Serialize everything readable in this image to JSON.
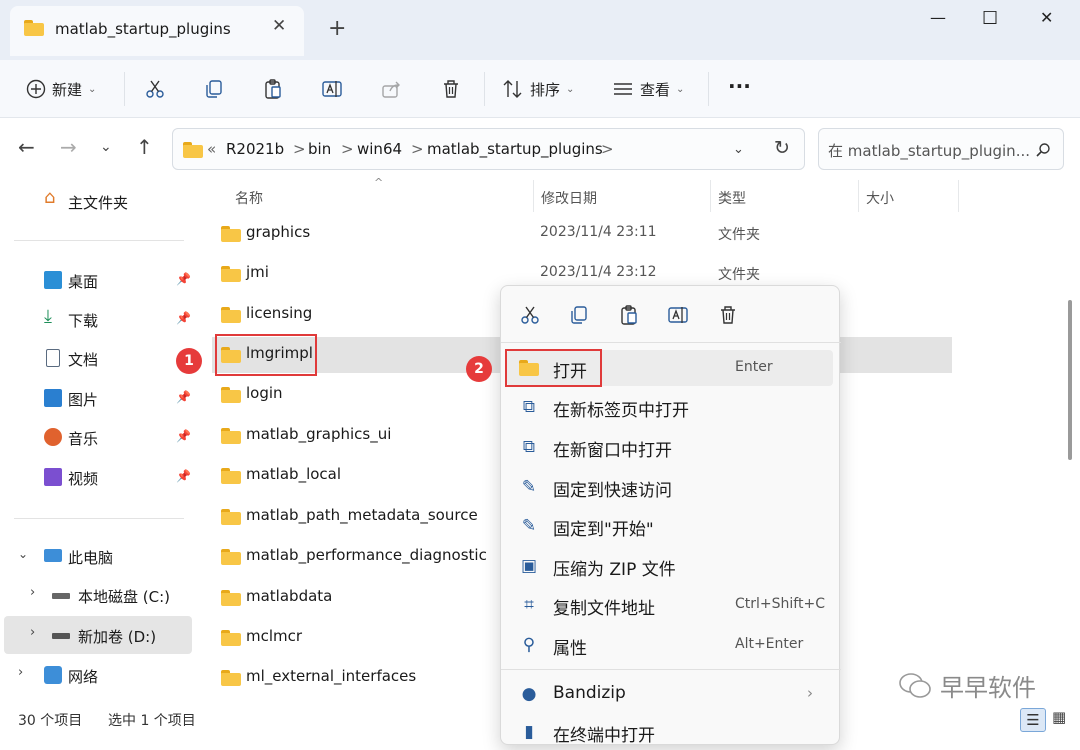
{
  "window": {
    "tab_title": "matlab_startup_plugins",
    "new_tab": "+",
    "minimize": "—",
    "maximize": "☐",
    "close": "✕"
  },
  "toolbar": {
    "new_label": "新建",
    "sort_label": "排序",
    "view_label": "查看",
    "more_label": "···"
  },
  "address": {
    "prefix": "«",
    "crumbs": [
      "R2021b",
      "bin",
      "win64",
      "matlab_startup_plugins"
    ],
    "separator": ">",
    "search_placeholder": "在 matlab_startup_plugin..."
  },
  "sidebar": {
    "home": "主文件夹",
    "quick": [
      {
        "label": "桌面",
        "icon": "desktop-icon",
        "color": "#2b8fd6"
      },
      {
        "label": "下载",
        "icon": "download-icon",
        "color": "#1f8f5a"
      },
      {
        "label": "文档",
        "icon": "document-icon",
        "color": "#5a6b80"
      },
      {
        "label": "图片",
        "icon": "pictures-icon",
        "color": "#2a7fd0"
      },
      {
        "label": "音乐",
        "icon": "music-icon",
        "color": "#e0622e"
      },
      {
        "label": "视频",
        "icon": "video-icon",
        "color": "#7b4fd0"
      }
    ],
    "this_pc": "此电脑",
    "drive_c": "本地磁盘 (C:)",
    "drive_d": "新加卷 (D:)",
    "network": "网络"
  },
  "columns": {
    "name": "名称",
    "modified": "修改日期",
    "type": "类型",
    "size": "大小"
  },
  "files": [
    {
      "name": "graphics",
      "date": "2023/11/4 23:11",
      "type": "文件夹"
    },
    {
      "name": "jmi",
      "date": "2023/11/4 23:12",
      "type": "文件夹"
    },
    {
      "name": "licensing",
      "date": "",
      "type": ""
    },
    {
      "name": "lmgrimpl",
      "date": "",
      "type": ""
    },
    {
      "name": "login",
      "date": "",
      "type": ""
    },
    {
      "name": "matlab_graphics_ui",
      "date": "",
      "type": ""
    },
    {
      "name": "matlab_local",
      "date": "",
      "type": ""
    },
    {
      "name": "matlab_path_metadata_source",
      "date": "",
      "type": ""
    },
    {
      "name": "matlab_performance_diagnostic",
      "date": "",
      "type": ""
    },
    {
      "name": "matlabdata",
      "date": "",
      "type": ""
    },
    {
      "name": "mclmcr",
      "date": "",
      "type": ""
    },
    {
      "name": "ml_external_interfaces",
      "date": "",
      "type": ""
    }
  ],
  "status": {
    "count": "30 个项目",
    "selected": "选中 1 个项目"
  },
  "context_menu": {
    "items": [
      {
        "label": "打开",
        "shortcut": "Enter",
        "icon": "folder-icon"
      },
      {
        "label": "在新标签页中打开",
        "shortcut": "",
        "icon": "new-tab-icon"
      },
      {
        "label": "在新窗口中打开",
        "shortcut": "",
        "icon": "new-window-icon"
      },
      {
        "label": "固定到快速访问",
        "shortcut": "",
        "icon": "pin-icon"
      },
      {
        "label": "固定到\"开始\"",
        "shortcut": "",
        "icon": "pin-icon"
      },
      {
        "label": "压缩为 ZIP 文件",
        "shortcut": "",
        "icon": "zip-icon"
      },
      {
        "label": "复制文件地址",
        "shortcut": "Ctrl+Shift+C",
        "icon": "copy-path-icon"
      },
      {
        "label": "属性",
        "shortcut": "Alt+Enter",
        "icon": "properties-icon"
      },
      {
        "label": "Bandizip",
        "shortcut": "",
        "icon": "bandizip-icon"
      },
      {
        "label": "在终端中打开",
        "shortcut": "",
        "icon": "terminal-icon"
      }
    ]
  },
  "annotations": {
    "badge1": "1",
    "badge2": "2"
  },
  "watermark": "早早软件",
  "colors": {
    "accent": "#0067c0",
    "selected_row": "#e3e3e3",
    "highlight": "#e03a3a"
  }
}
